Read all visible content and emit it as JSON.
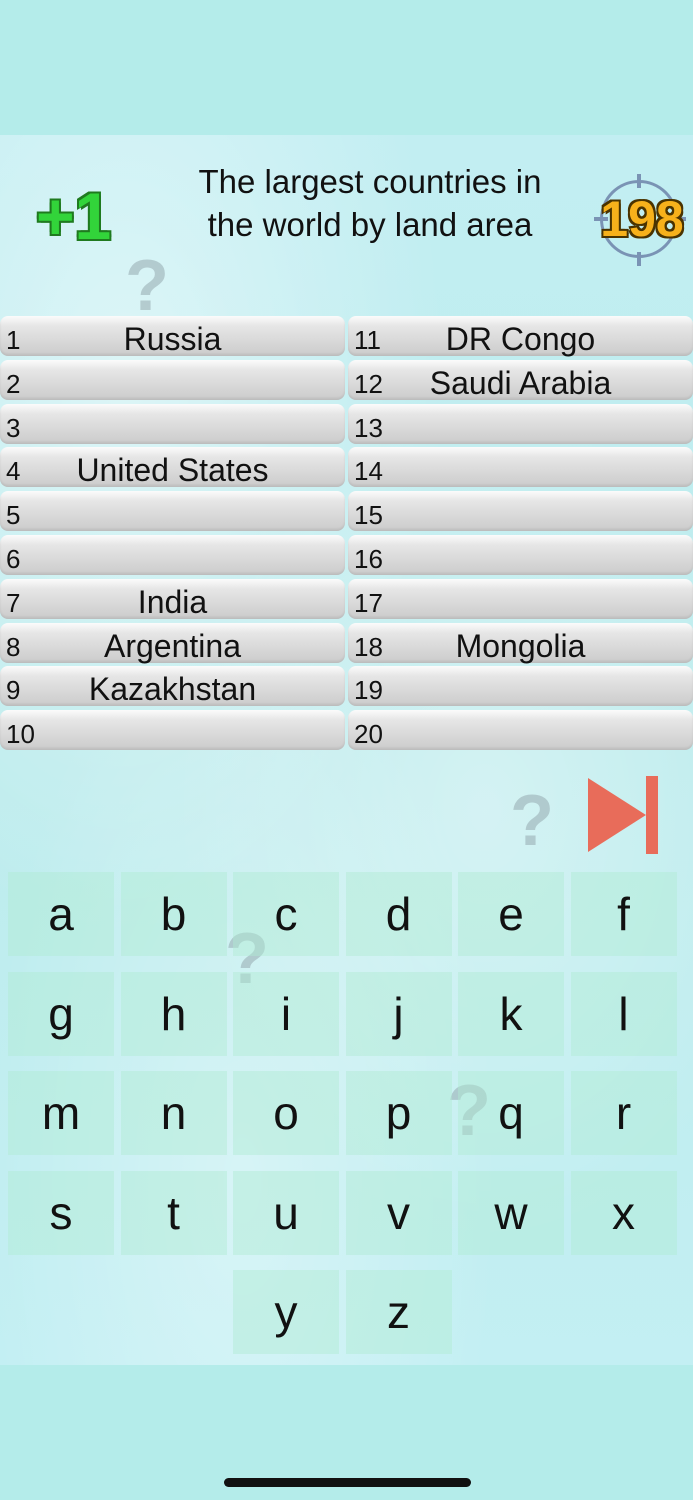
{
  "header": {
    "score_gain": "+1",
    "title": "The largest countries in the world by land area",
    "timer": "198"
  },
  "answers_left": [
    {
      "num": "1",
      "answer": "Russia"
    },
    {
      "num": "2",
      "answer": ""
    },
    {
      "num": "3",
      "answer": ""
    },
    {
      "num": "4",
      "answer": "United States"
    },
    {
      "num": "5",
      "answer": ""
    },
    {
      "num": "6",
      "answer": ""
    },
    {
      "num": "7",
      "answer": "India"
    },
    {
      "num": "8",
      "answer": "Argentina"
    },
    {
      "num": "9",
      "answer": "Kazakhstan"
    },
    {
      "num": "10",
      "answer": ""
    }
  ],
  "answers_right": [
    {
      "num": "11",
      "answer": "DR Congo"
    },
    {
      "num": "12",
      "answer": "Saudi Arabia"
    },
    {
      "num": "13",
      "answer": ""
    },
    {
      "num": "14",
      "answer": ""
    },
    {
      "num": "15",
      "answer": ""
    },
    {
      "num": "16",
      "answer": ""
    },
    {
      "num": "17",
      "answer": ""
    },
    {
      "num": "18",
      "answer": "Mongolia"
    },
    {
      "num": "19",
      "answer": ""
    },
    {
      "num": "20",
      "answer": ""
    }
  ],
  "keyboard": {
    "row1": [
      "a",
      "b",
      "c",
      "d",
      "e",
      "f"
    ],
    "row2": [
      "g",
      "h",
      "i",
      "j",
      "k",
      "l"
    ],
    "row3": [
      "m",
      "n",
      "o",
      "p",
      "q",
      "r"
    ],
    "row4": [
      "s",
      "t",
      "u",
      "v",
      "w",
      "x"
    ],
    "row5": [
      "y",
      "z"
    ]
  },
  "decor": {
    "question_mark": "?"
  },
  "icons": {
    "skip": "skip-forward-icon",
    "timer": "crosshair-timer-icon"
  },
  "colors": {
    "score_gain": "#32d43a",
    "timer": "#f7b11b",
    "skip": "#e86c5a",
    "background": "#b4ecea"
  }
}
